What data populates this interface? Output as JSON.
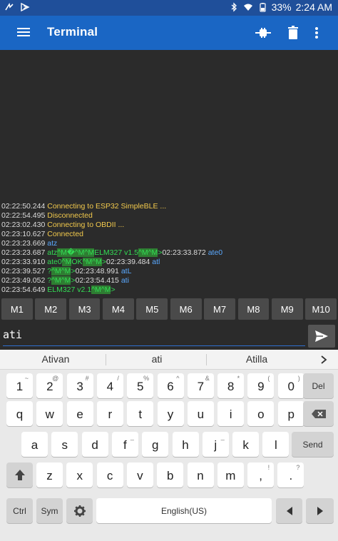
{
  "status": {
    "battery": "33%",
    "time": "2:24 AM"
  },
  "appbar": {
    "title": "Terminal"
  },
  "terminal": {
    "lines": [
      [
        {
          "t": "02:22:50.244 ",
          "c": "ts"
        },
        {
          "t": "Connecting to ESP32 SimpleBLE ...",
          "c": "info"
        }
      ],
      [
        {
          "t": "02:22:54.495 ",
          "c": "ts"
        },
        {
          "t": "Disconnected",
          "c": "info"
        }
      ],
      [
        {
          "t": "02:23:02.430 ",
          "c": "ts"
        },
        {
          "t": "Connecting to OBDII ...",
          "c": "info"
        }
      ],
      [
        {
          "t": "02:23:10.627 ",
          "c": "ts"
        },
        {
          "t": "Connected",
          "c": "info"
        }
      ],
      [
        {
          "t": "02:23:23.669 ",
          "c": "ts"
        },
        {
          "t": "atz",
          "c": "tx"
        }
      ],
      [
        {
          "t": "02:23:23.687 ",
          "c": "ts"
        },
        {
          "t": "atz",
          "c": "rx"
        },
        {
          "t": "^M",
          "c": "ctl"
        },
        {
          "t": "�",
          "c": "ctl"
        },
        {
          "t": "^M^M",
          "c": "ctl"
        },
        {
          "t": "ELM327 v1.5",
          "c": "rx"
        },
        {
          "t": "^M^M",
          "c": "ctl"
        },
        {
          "t": ">",
          "c": "rx"
        },
        {
          "t": "02:23:33.872 ",
          "c": "ts"
        },
        {
          "t": "ate0",
          "c": "tx"
        }
      ],
      [
        {
          "t": "02:23:33.910 ",
          "c": "ts"
        },
        {
          "t": "ate0",
          "c": "rx"
        },
        {
          "t": "^M",
          "c": "ctl"
        },
        {
          "t": "OK",
          "c": "rx"
        },
        {
          "t": "^M^M",
          "c": "ctl"
        },
        {
          "t": ">",
          "c": "rx"
        },
        {
          "t": "02:23:39.484 ",
          "c": "ts"
        },
        {
          "t": "atl",
          "c": "tx"
        }
      ],
      [
        {
          "t": "02:23:39.527 ",
          "c": "ts"
        },
        {
          "t": "?",
          "c": "rx"
        },
        {
          "t": "^M^M",
          "c": "ctl"
        },
        {
          "t": ">",
          "c": "rx"
        },
        {
          "t": "02:23:48.991 ",
          "c": "ts"
        },
        {
          "t": "atL",
          "c": "tx"
        }
      ],
      [
        {
          "t": "02:23:49.052 ",
          "c": "ts"
        },
        {
          "t": "?",
          "c": "rx"
        },
        {
          "t": "^M^M",
          "c": "ctl"
        },
        {
          "t": ">",
          "c": "rx"
        },
        {
          "t": "02:23:54.415 ",
          "c": "ts"
        },
        {
          "t": "ati",
          "c": "tx"
        }
      ],
      [
        {
          "t": "02:23:54.649 ",
          "c": "ts"
        },
        {
          "t": "ELM327 v2.1",
          "c": "rx"
        },
        {
          "t": "^M^M",
          "c": "ctl"
        },
        {
          "t": ">",
          "c": "rx"
        }
      ]
    ]
  },
  "macros": [
    "M1",
    "M2",
    "M3",
    "M4",
    "M5",
    "M6",
    "M7",
    "M8",
    "M9",
    "M10"
  ],
  "input": {
    "value": "ati"
  },
  "keyboard": {
    "suggestions": [
      "Ativan",
      "ati",
      "Atilla"
    ],
    "numrow": [
      [
        "1",
        "~"
      ],
      [
        "2",
        "@"
      ],
      [
        "3",
        "#"
      ],
      [
        "4",
        "/"
      ],
      [
        "5",
        "%"
      ],
      [
        "6",
        "^"
      ],
      [
        "7",
        "&"
      ],
      [
        "8",
        "*"
      ],
      [
        "9",
        "("
      ],
      [
        "0",
        ")"
      ]
    ],
    "row1": [
      [
        "q",
        ""
      ],
      [
        "w",
        ""
      ],
      [
        "e",
        ""
      ],
      [
        "r",
        ""
      ],
      [
        "t",
        ""
      ],
      [
        "y",
        ""
      ],
      [
        "u",
        ""
      ],
      [
        "i",
        ""
      ],
      [
        "o",
        ""
      ],
      [
        "p",
        ""
      ]
    ],
    "row2": [
      [
        "a",
        ""
      ],
      [
        "s",
        ""
      ],
      [
        "d",
        ""
      ],
      [
        "f",
        "_"
      ],
      [
        "g",
        ""
      ],
      [
        "h",
        ""
      ],
      [
        "j",
        "_"
      ],
      [
        "k",
        ""
      ],
      [
        "l",
        ""
      ]
    ],
    "row3": [
      [
        "z",
        ""
      ],
      [
        "x",
        ""
      ],
      [
        "c",
        ""
      ],
      [
        "v",
        ""
      ],
      [
        "b",
        ""
      ],
      [
        "n",
        ""
      ],
      [
        "m",
        ""
      ],
      [
        ",",
        "!"
      ],
      [
        ".",
        "?"
      ]
    ],
    "del_label": "Del",
    "send_label": "Send",
    "ctrl_label": "Ctrl",
    "sym_label": "Sym",
    "space_label": "English(US)"
  }
}
